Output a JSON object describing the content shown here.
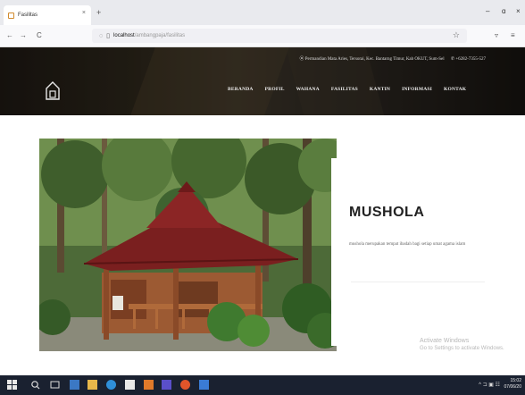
{
  "browser": {
    "tab_title": "Fasilitas",
    "close_tab": "×",
    "new_tab": "+",
    "window_controls": {
      "minimize": "–",
      "maximize": "ɑ",
      "close": "×"
    },
    "nav": {
      "back": "←",
      "forward": "→",
      "reload": "C"
    },
    "url_host": "localhost",
    "url_path": "/ambangpaja/fasilitas",
    "icons": [
      "shield-icon",
      "page-icon",
      "star-icon",
      "pocket-icon",
      "menu-icon"
    ]
  },
  "site": {
    "contact_address": "Permandian Mata Aries, Tersorai, Kec. Bantarng Timur, Kab OKUT, Sum-Sel",
    "contact_phone": "+6282-7355-527",
    "menu": [
      "BERANDA",
      "PROFIL",
      "WAHANA",
      "FASILITAS",
      "KANTIN",
      "INFORMASI",
      "KONTAK"
    ]
  },
  "facility": {
    "title": "MUSHOLA",
    "description": "mushola merupakan tempat ibadah bagi setiap umat agama islam"
  },
  "watermark": {
    "line1": "Activate Windows",
    "line2": "Go to Settings to activate Windows."
  },
  "taskbar": {
    "clock_time": "15:02",
    "clock_date": "07/06/20",
    "icons": [
      "windows-start-icon",
      "search-icon",
      "task-view-icon",
      "file-explorer-icon",
      "folder-icon",
      "edge-icon",
      "store-icon",
      "xampp-icon",
      "app-icon",
      "firefox-icon",
      "app-icon",
      "chart-icon"
    ]
  },
  "colors": {
    "header_bg": "#221d17",
    "menu_text": "#f0f0f0",
    "taskbar_bg": "#1a2130",
    "roof": "#7a1f1f",
    "wood": "#a0522d"
  }
}
